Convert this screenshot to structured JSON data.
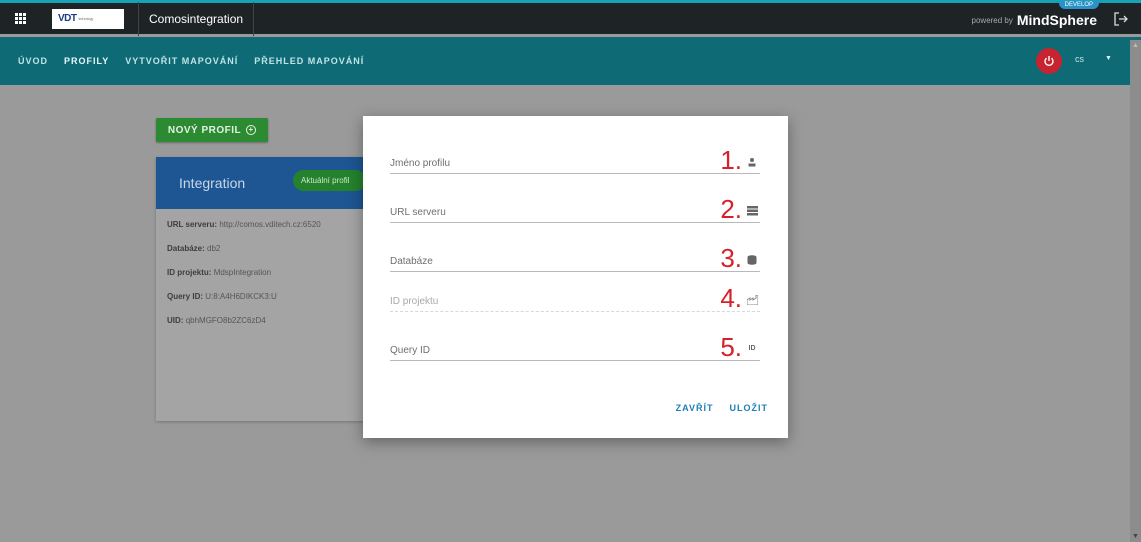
{
  "topbar": {
    "app_title": "Comosintegration",
    "logo_text": "VDT",
    "logo_sub": "technology",
    "powered_by": "powered by",
    "brand": "MindSphere",
    "dev_tag": "DEVELOP"
  },
  "nav": {
    "items": [
      {
        "label": "ÚVOD"
      },
      {
        "label": "PROFILY"
      },
      {
        "label": "VYTVOŘIT MAPOVÁNÍ"
      },
      {
        "label": "PŘEHLED MAPOVÁNÍ"
      }
    ],
    "language": "cs"
  },
  "page": {
    "new_profile_button": "NOVÝ PROFIL",
    "card": {
      "title": "Integration",
      "badge": "Aktuální profil",
      "rows": [
        {
          "key": "URL serveru:",
          "value": "http://comos.vditech.cz:6520"
        },
        {
          "key": "Databáze:",
          "value": "db2"
        },
        {
          "key": "ID projektu:",
          "value": "MdspIntegration"
        },
        {
          "key": "Query ID:",
          "value": "U:8:A4H6DIKCK3:U"
        },
        {
          "key": "UID:",
          "value": "qbhMGFO8b2ZC6zD4"
        }
      ]
    }
  },
  "modal": {
    "fields": [
      {
        "label": "Jméno profilu",
        "number": "1.",
        "icon": "person-icon"
      },
      {
        "label": "URL serveru",
        "number": "2.",
        "icon": "server-icon"
      },
      {
        "label": "Databáze",
        "number": "3.",
        "icon": "database-icon"
      },
      {
        "label": "ID projektu",
        "number": "4.",
        "icon": "factory-icon"
      },
      {
        "label": "Query ID",
        "number": "5.",
        "icon": "id-icon",
        "icon_text": "ID"
      }
    ],
    "close_button": "ZAVŘÍT",
    "save_button": "ULOŽIT"
  },
  "colors": {
    "topbar": "#1e2326",
    "navbar": "#0e6a74",
    "accent_red": "#d6202b",
    "link_blue": "#1d7fb8",
    "green_button": "#2b8a32",
    "card_header": "#1d5693"
  }
}
